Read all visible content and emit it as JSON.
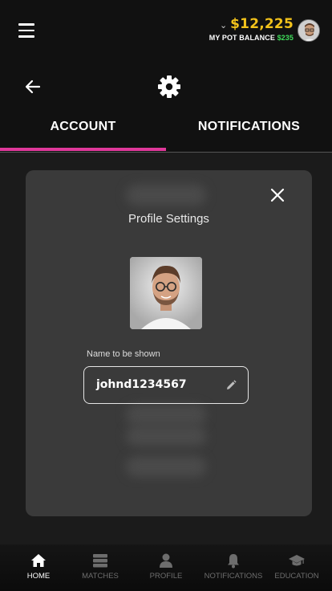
{
  "header": {
    "balance": "$12,225",
    "pot_label": "MY POT BALANCE",
    "pot_value": "$235"
  },
  "tabs": [
    {
      "label": "ACCOUNT",
      "active": true
    },
    {
      "label": "NOTIFICATIONS",
      "active": false
    }
  ],
  "modal": {
    "title": "Profile Settings",
    "name_label": "Name to be shown",
    "name_value": "johnd1234567"
  },
  "nav": [
    {
      "label": "HOME",
      "icon": "home-icon",
      "active": true
    },
    {
      "label": "MATCHES",
      "icon": "matches-icon",
      "active": false
    },
    {
      "label": "PROFILE",
      "icon": "profile-icon",
      "active": false
    },
    {
      "label": "NOTIFICATIONS",
      "icon": "bell-icon",
      "active": false
    },
    {
      "label": "EDUCATION",
      "icon": "graduation-cap-icon",
      "active": false
    }
  ],
  "colors": {
    "accent": "#e0389a",
    "balance": "#f2c21b",
    "pot_value": "#3fdc5a"
  }
}
